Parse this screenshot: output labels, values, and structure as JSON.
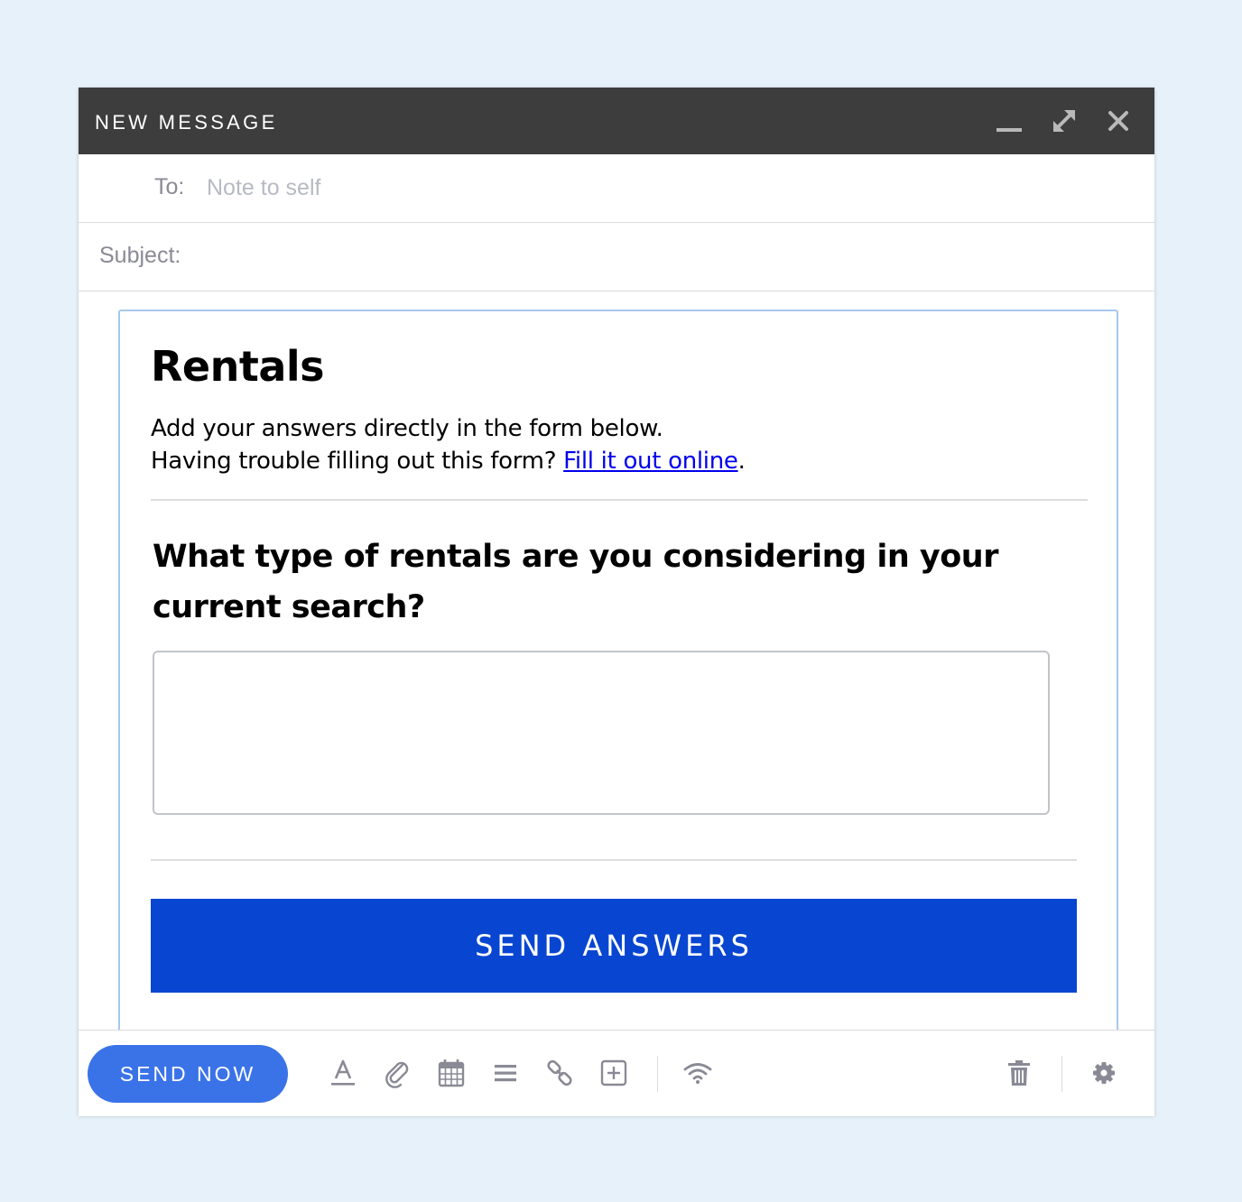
{
  "window": {
    "title": "NEW MESSAGE",
    "controls": {
      "minimize_icon": "minimize-icon",
      "expand_icon": "expand-icon",
      "close_icon": "close-icon"
    }
  },
  "compose": {
    "to_label": "To:",
    "to_placeholder": "Note to self",
    "to_value": "",
    "subject_label": "Subject:",
    "subject_value": ""
  },
  "form": {
    "title": "Rentals",
    "intro_line1": "Add your answers directly in the form below.",
    "intro_line2_prefix": "Having trouble filling out this form? ",
    "intro_link": "Fill it out online",
    "intro_line2_suffix": ".",
    "question": "What type of rentals are you considering in your current search?",
    "answer_value": "",
    "submit_label": "SEND ANSWERS"
  },
  "toolbar": {
    "send_label": "SEND NOW",
    "icons": [
      "text-format-icon",
      "attachment-icon",
      "calendar-icon",
      "list-icon",
      "link-icon",
      "add-icon",
      "wifi-icon",
      "trash-icon",
      "gear-icon"
    ]
  },
  "colors": {
    "titlebar": "#3d3d3d",
    "submit_button": "#0846d1",
    "send_button": "#3a73e8",
    "background": "#e6f1f9",
    "link": "#0000ee",
    "icon": "#8a8a96"
  }
}
